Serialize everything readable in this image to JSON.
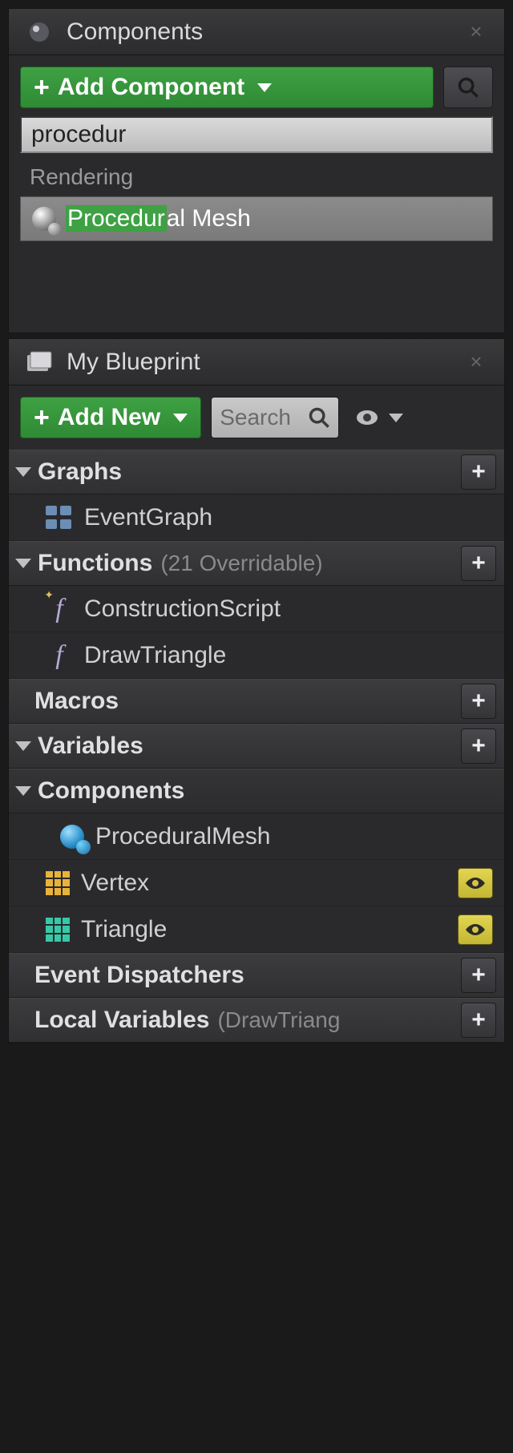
{
  "components_panel": {
    "title": "Components",
    "add_button": "Add Component",
    "search_value": "procedur",
    "search_section": "Rendering",
    "result_highlight": "Procedur",
    "result_rest": "al Mesh"
  },
  "blueprint_panel": {
    "title": "My Blueprint",
    "add_button": "Add New",
    "search_placeholder": "Search",
    "categories": {
      "graphs": {
        "label": "Graphs"
      },
      "functions": {
        "label": "Functions",
        "note": "(21 Overridable)"
      },
      "macros": {
        "label": "Macros"
      },
      "variables": {
        "label": "Variables"
      },
      "components": {
        "label": "Components"
      },
      "event_dispatchers": {
        "label": "Event Dispatchers"
      },
      "local_variables": {
        "label": "Local Variables",
        "note": "(DrawTriang"
      }
    },
    "items": {
      "event_graph": "EventGraph",
      "construction_script": "ConstructionScript",
      "draw_triangle": "DrawTriangle",
      "procedural_mesh": "ProceduralMesh",
      "vertex": "Vertex",
      "triangle": "Triangle"
    }
  }
}
